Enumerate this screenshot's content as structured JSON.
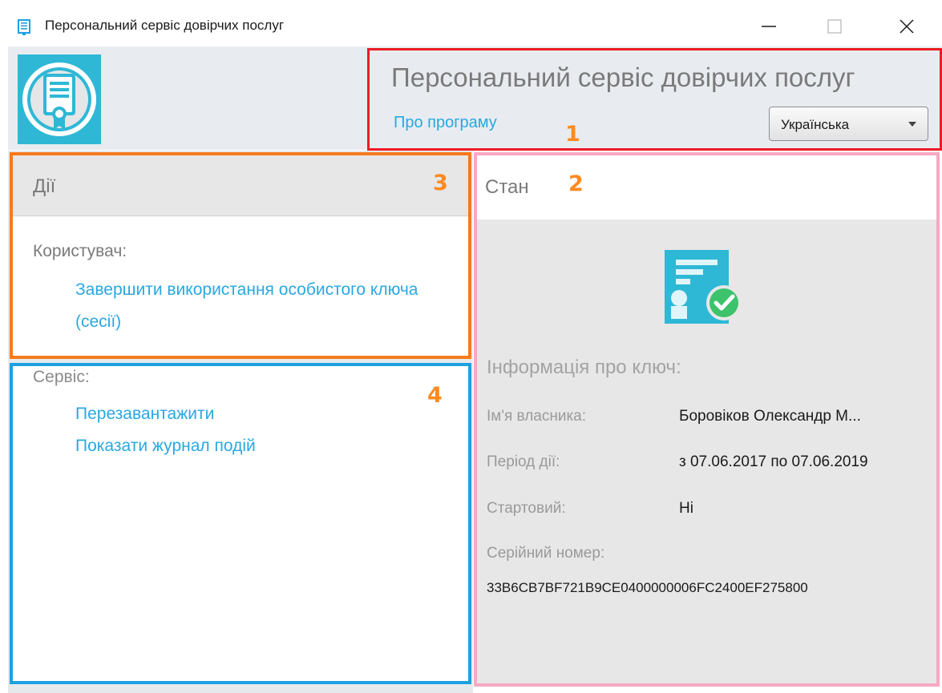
{
  "window": {
    "title": "Персональний сервіс довірчих послуг",
    "icon": "app-window-icon",
    "controls": [
      "minimize-icon",
      "maximize-icon",
      "close-icon"
    ]
  },
  "header": {
    "app_title": "Персональний сервіс довірчих послуг",
    "about_link": "Про програму",
    "language": {
      "selected": "Українська"
    },
    "logo_icon": "certificate-icon"
  },
  "annotations": {
    "header": "1",
    "status": "2",
    "actions": "3",
    "service": "4"
  },
  "actions": {
    "title": "Дії",
    "user_label": "Користувач:",
    "end_session_link": "Завершити використання особистого ключа (сесії)"
  },
  "service": {
    "label": "Сервіс:",
    "reload_link": "Перезавантажити",
    "event_log_link": "Показати журнал подій"
  },
  "status": {
    "title": "Стан",
    "key_icon": "key-valid-icon",
    "key_info_title": "Інформація про ключ:",
    "fields": [
      {
        "label": "Ім'я власника:",
        "value": "Боровіков Олександр М..."
      },
      {
        "label": "Період дії:",
        "value": "з 07.06.2017 по 07.06.2019"
      },
      {
        "label": "Стартовий:",
        "value": "Ні"
      }
    ],
    "serial_label": "Серійний номер:",
    "serial_value": "33B6CB7BF721B9CE0400000006FC2400EF275800"
  },
  "colors": {
    "accent_link": "#29a8e0",
    "annotation_number": "#ff8a1f",
    "box_header": "#ed1c24",
    "box_status": "#f7a8c3",
    "box_actions": "#f47b20",
    "box_service": "#1ba1e2",
    "logo_bg": "#2eb8d6",
    "check_green": "#3cc36b"
  }
}
